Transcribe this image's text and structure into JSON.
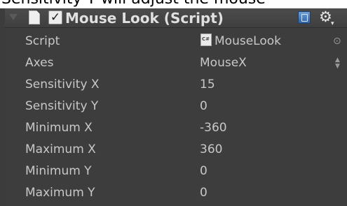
{
  "caption_text": "Sensitivity Y will adjust the mouse",
  "component": {
    "title": "Mouse Look (Script)",
    "enabled_check": "✓",
    "icons": {
      "foldout": "foldout-arrow-icon",
      "script": "script-icon",
      "help": "help-icon",
      "settings": "gear-icon"
    }
  },
  "properties": [
    {
      "label": "Script",
      "value": "MouseLook"
    },
    {
      "label": "Axes",
      "value": "MouseX"
    },
    {
      "label": "Sensitivity X",
      "value": "15"
    },
    {
      "label": "Sensitivity Y",
      "value": "0"
    },
    {
      "label": "Minimum X",
      "value": "-360"
    },
    {
      "label": "Maximum X",
      "value": "360"
    },
    {
      "label": "Minimum Y",
      "value": "0"
    },
    {
      "label": "Maximum Y",
      "value": "0"
    }
  ]
}
